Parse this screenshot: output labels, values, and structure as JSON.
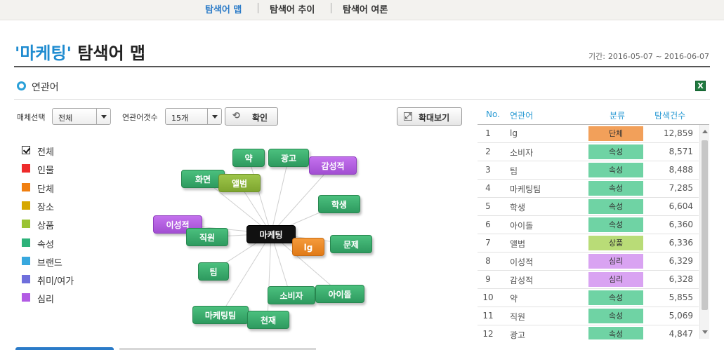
{
  "nav": {
    "tabs": [
      {
        "label": "탐색어 맵",
        "active": true
      },
      {
        "label": "탐색어 추이",
        "active": false
      },
      {
        "label": "탐색어 여론",
        "active": false
      }
    ]
  },
  "header": {
    "keyword": "'마케팅'",
    "title_suffix": " 탐색어 맵",
    "period_label": "기간:",
    "period_value": "2016-05-07 ~ 2016-06-07"
  },
  "section": {
    "title": "연관어",
    "excel_icon": "excel-icon",
    "excel_glyph": "X"
  },
  "controls": {
    "media_label": "매체선택",
    "media_value": "전체",
    "count_label": "연관어갯수",
    "count_value": "15개",
    "confirm_label": "확인",
    "expand_label": "확대보기",
    "confirm_icon": "refresh-icon",
    "expand_icon": "expand-icon"
  },
  "legend": [
    {
      "label": "전체",
      "color": "#ffffff",
      "checked": true
    },
    {
      "label": "인물",
      "color": "#ee2b2b"
    },
    {
      "label": "단체",
      "color": "#f07f10"
    },
    {
      "label": "장소",
      "color": "#d6a800"
    },
    {
      "label": "상품",
      "color": "#9ac434"
    },
    {
      "label": "속성",
      "color": "#2db27a"
    },
    {
      "label": "브랜드",
      "color": "#38a8de"
    },
    {
      "label": "취미/여가",
      "color": "#6f6fdc"
    },
    {
      "label": "심리",
      "color": "#b25be4"
    }
  ],
  "graph": {
    "center": "마케팅",
    "nodes": [
      "약",
      "광고",
      "감성적",
      "화면",
      "앨범",
      "학생",
      "이성적",
      "직원",
      "lg",
      "문제",
      "팀",
      "소비자",
      "아이돌",
      "마케팅팀",
      "천재"
    ]
  },
  "table": {
    "headers": {
      "no": "No.",
      "keyword": "연관어",
      "category": "분류",
      "count": "탐색건수"
    },
    "rows": [
      {
        "no": "1",
        "keyword": "lg",
        "category": "단체",
        "count": "12,859",
        "color": "#f2a05a"
      },
      {
        "no": "2",
        "keyword": "소비자",
        "category": "속성",
        "count": "8,571",
        "color": "#6fd3a4"
      },
      {
        "no": "3",
        "keyword": "팀",
        "category": "속성",
        "count": "8,488",
        "color": "#6fd3a4"
      },
      {
        "no": "4",
        "keyword": "마케팅팀",
        "category": "속성",
        "count": "7,285",
        "color": "#6fd3a4"
      },
      {
        "no": "5",
        "keyword": "학생",
        "category": "속성",
        "count": "6,604",
        "color": "#6fd3a4"
      },
      {
        "no": "6",
        "keyword": "아이돌",
        "category": "속성",
        "count": "6,360",
        "color": "#6fd3a4"
      },
      {
        "no": "7",
        "keyword": "앨범",
        "category": "상품",
        "count": "6,336",
        "color": "#b9dc77"
      },
      {
        "no": "8",
        "keyword": "이성적",
        "category": "심리",
        "count": "6,329",
        "color": "#d9a3f2"
      },
      {
        "no": "9",
        "keyword": "감성적",
        "category": "심리",
        "count": "6,328",
        "color": "#d9a3f2"
      },
      {
        "no": "10",
        "keyword": "약",
        "category": "속성",
        "count": "5,855",
        "color": "#6fd3a4"
      },
      {
        "no": "11",
        "keyword": "직원",
        "category": "속성",
        "count": "5,069",
        "color": "#6fd3a4"
      },
      {
        "no": "12",
        "keyword": "광고",
        "category": "속성",
        "count": "4,847",
        "color": "#6fd3a4"
      }
    ]
  }
}
